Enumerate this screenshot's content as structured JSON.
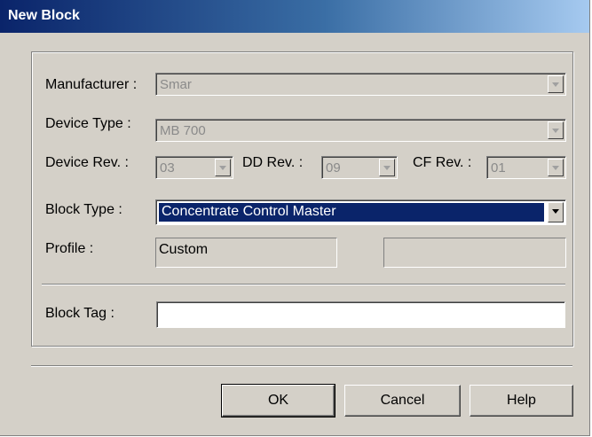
{
  "window": {
    "title": "New Block"
  },
  "form": {
    "manufacturer": {
      "label": "Manufacturer :",
      "value": "Smar"
    },
    "device_type": {
      "label": "Device Type :",
      "value": "MB 700"
    },
    "device_rev": {
      "label": "Device Rev. :",
      "value": "03"
    },
    "dd_rev": {
      "label": "DD Rev. :",
      "value": "09"
    },
    "cf_rev": {
      "label": "CF Rev. :",
      "value": "01"
    },
    "block_type": {
      "label": "Block Type :",
      "value": "Concentrate Control Master"
    },
    "profile": {
      "label": "Profile :",
      "value": "Custom",
      "value2": ""
    },
    "block_tag": {
      "label": "Block Tag :",
      "value": "",
      "placeholder": ""
    }
  },
  "buttons": {
    "ok": "OK",
    "cancel": "Cancel",
    "help": "Help"
  },
  "colors": {
    "title_bar_start": "#0a246a",
    "title_bar_end": "#a6caf0",
    "dialog_bg": "#d4d0c8",
    "selection": "#0a246a"
  },
  "icons": {
    "dropdown": "chevron-down-icon"
  }
}
